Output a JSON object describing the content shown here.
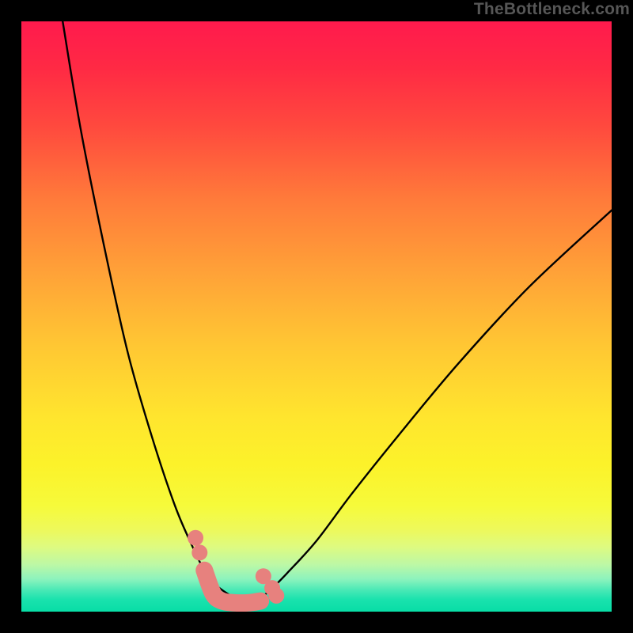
{
  "attribution": "TheBottleneck.com",
  "colors": {
    "background": "#000000",
    "gradient_top": "#ff1a4d",
    "gradient_bottom": "#08dda6",
    "curve": "#000000",
    "marker": "#e7817e"
  },
  "chart_data": {
    "type": "line",
    "title": "",
    "xlabel": "",
    "ylabel": "",
    "xlim": [
      0,
      100
    ],
    "ylim": [
      0,
      100
    ],
    "series": [
      {
        "name": "left-curve",
        "x": [
          7,
          10,
          14,
          18,
          22,
          26,
          29,
          31,
          33,
          35,
          37,
          38.5
        ],
        "y": [
          100,
          82,
          62,
          44,
          30,
          18,
          11,
          7,
          4.5,
          3,
          2,
          1.5
        ]
      },
      {
        "name": "right-curve",
        "x": [
          38.5,
          40,
          42,
          45,
          50,
          56,
          64,
          74,
          86,
          100
        ],
        "y": [
          1.5,
          2,
          3.5,
          6.5,
          12,
          20,
          30,
          42,
          55,
          68
        ]
      }
    ],
    "markers": {
      "name": "bottom-cluster",
      "points": [
        {
          "x": 29.5,
          "y": 12.5
        },
        {
          "x": 30.2,
          "y": 10.0
        },
        {
          "x": 41.0,
          "y": 6.0
        },
        {
          "x": 42.5,
          "y": 4.0
        },
        {
          "x": 43.2,
          "y": 2.7
        }
      ],
      "worm": {
        "x": [
          31.0,
          32.5,
          34.0,
          36.0,
          38.5,
          40.5
        ],
        "y": [
          7.0,
          3.0,
          1.8,
          1.5,
          1.5,
          1.8
        ]
      }
    }
  }
}
